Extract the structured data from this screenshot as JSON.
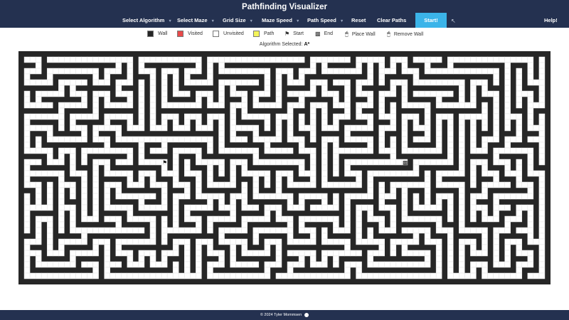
{
  "app": {
    "title": "Pathfinding Visualizer"
  },
  "nav": {
    "select_algorithm": "Select Algorithm",
    "select_maze": "Select Maze",
    "grid_size": "Grid Size",
    "maze_speed": "Maze Speed",
    "path_speed": "Path Speed",
    "reset": "Reset",
    "clear_paths": "Clear Paths",
    "start": "Start!",
    "help": "Help!",
    "caret": "▼"
  },
  "legend": {
    "wall": "Wall",
    "visited": "Visited",
    "unvisited": "Unvisited",
    "path": "Path",
    "start": "Start",
    "end": "End",
    "place_wall": "Place Wall",
    "remove_wall": "Remove Wall"
  },
  "algorithm": {
    "label": "Algorithm Selected:",
    "value": "A*"
  },
  "footer": {
    "text": "© 2024 Tyler Mommsen"
  },
  "colors": {
    "header_bg": "#243150",
    "start_button": "#3bb4e9",
    "wall": "#262626",
    "visited": "#e84a4a",
    "unvisited": "#ffffff",
    "path": "#f4f45a",
    "cell_grid_line": "#e3e3e3"
  },
  "grid": {
    "rows": 41,
    "cols": 93
  },
  "icons": {
    "start": "flag-icon",
    "end": "checkered-flag-icon",
    "place_wall": "mouse-left-icon",
    "remove_wall": "mouse-right-icon",
    "github": "github-icon"
  }
}
